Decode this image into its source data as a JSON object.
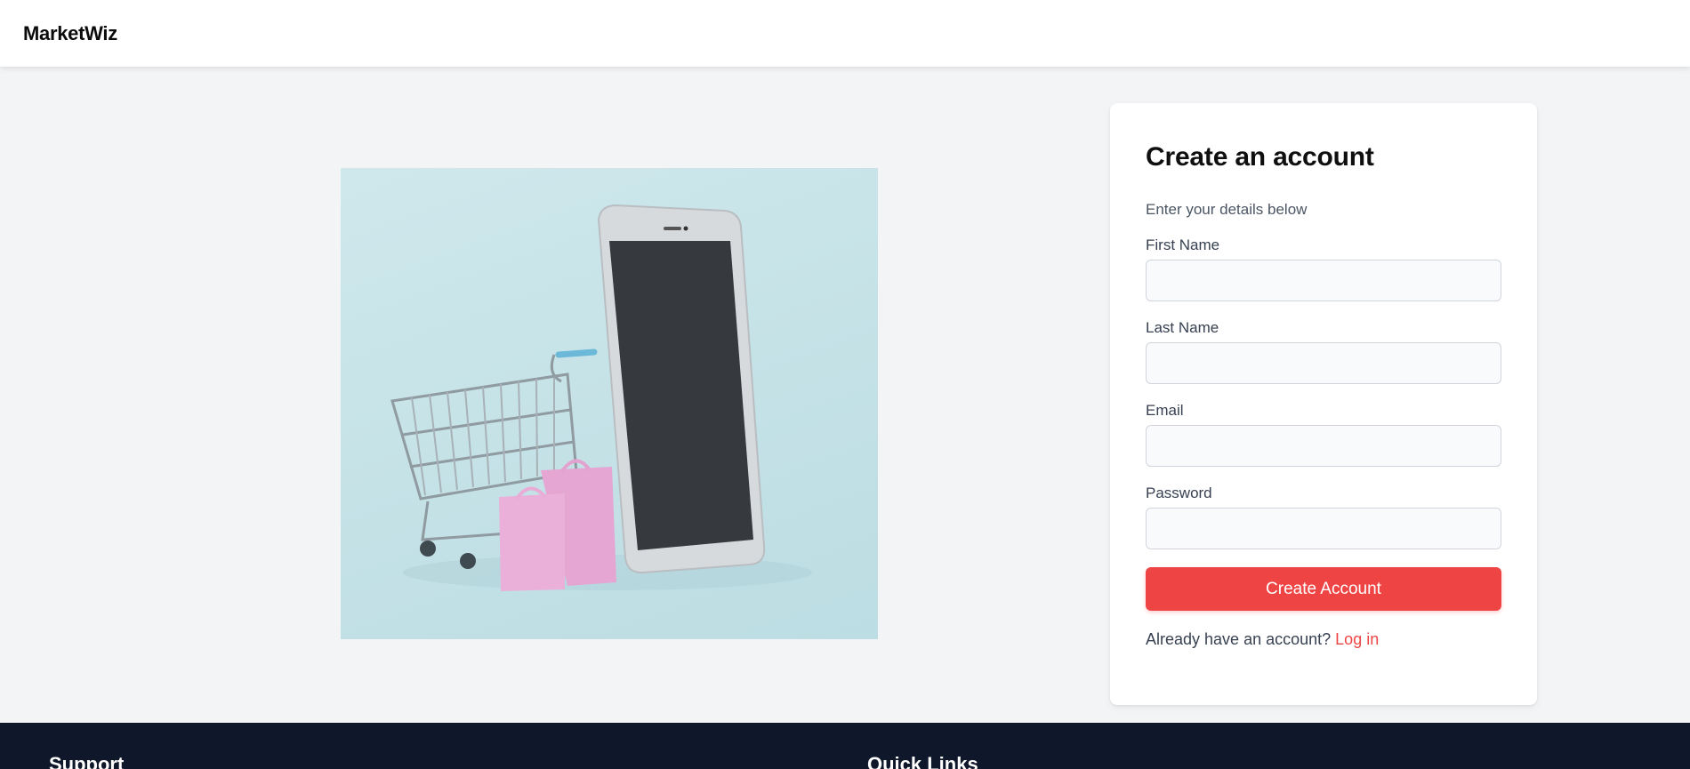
{
  "header": {
    "brand": "MarketWiz"
  },
  "hero": {
    "image_alt": "shopping-cart-phone-bags-illustration"
  },
  "form": {
    "title": "Create an account",
    "subtitle": "Enter your details below",
    "fields": [
      {
        "label": "First Name",
        "value": "",
        "placeholder": ""
      },
      {
        "label": "Last Name",
        "value": "",
        "placeholder": ""
      },
      {
        "label": "Email",
        "value": "",
        "placeholder": ""
      },
      {
        "label": "Password",
        "value": "",
        "placeholder": ""
      }
    ],
    "submit_label": "Create Account",
    "login_prompt": "Already have an account?",
    "login_link": "Log in"
  },
  "footer": {
    "headings": [
      "Support",
      "Quick Links"
    ]
  },
  "colors": {
    "accent": "#ef4444",
    "footer_bg": "#0f172a",
    "page_bg": "#f3f4f6"
  }
}
